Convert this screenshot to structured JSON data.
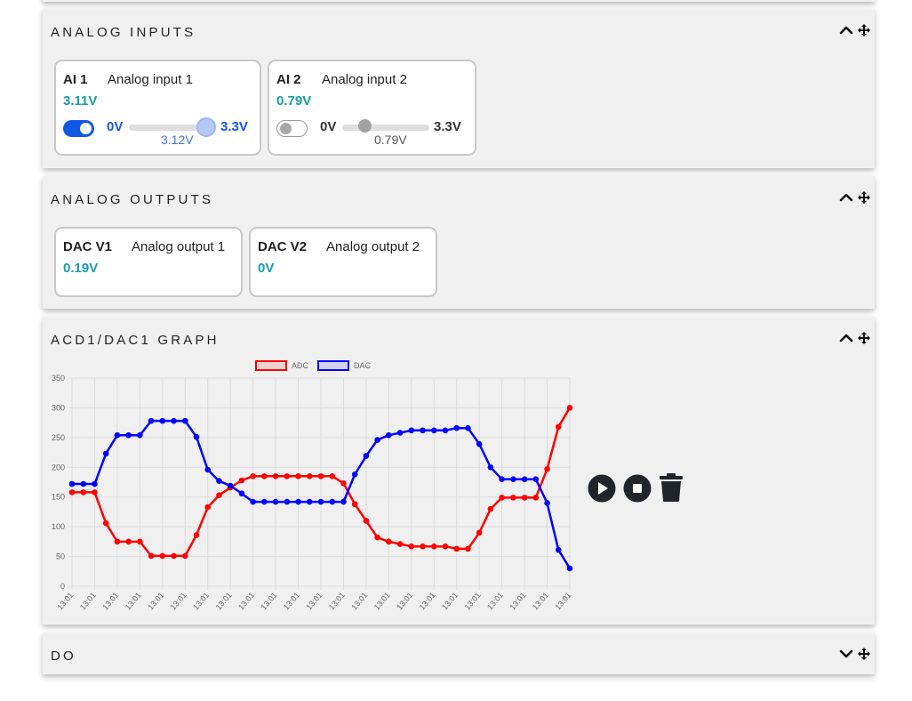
{
  "panels": {
    "analog_inputs": {
      "title": "ANALOG INPUTS"
    },
    "analog_outputs": {
      "title": "ANALOG OUTPUTS"
    },
    "graph": {
      "title": "ACD1/DAC1 GRAPH"
    },
    "do": {
      "title": "DO"
    }
  },
  "analog_inputs": [
    {
      "name": "AI 1",
      "description": "Analog input 1",
      "value": "3.11V",
      "toggle_on": true,
      "range_min": "0V",
      "range_max": "3.3V",
      "slider_value": "3.12V",
      "slider_fraction": 0.945
    },
    {
      "name": "AI 2",
      "description": "Analog input 2",
      "value": "0.79V",
      "toggle_on": false,
      "range_min": "0V",
      "range_max": "3.3V",
      "slider_value": "0.79V",
      "slider_fraction": 0.24
    }
  ],
  "analog_outputs": [
    {
      "name": "DAC V1",
      "description": "Analog output 1",
      "value": "0.19V"
    },
    {
      "name": "DAC V2",
      "description": "Analog output 2",
      "value": "0V"
    }
  ],
  "colors": {
    "accent": "#1357e6",
    "value_teal": "#1a9ca8",
    "adc": "#ff0000",
    "dac": "#0000ff",
    "panel_bg": "#f0f0f0"
  },
  "icons": [
    "chevron-up-icon",
    "move-arrows-icon",
    "chevron-down-icon",
    "play-icon",
    "stop-icon",
    "trash-icon"
  ],
  "chart_data": {
    "type": "line",
    "title": "",
    "xlabel": "",
    "ylabel": "",
    "ylim": [
      0,
      350
    ],
    "yticks": [
      0,
      50,
      100,
      150,
      200,
      250,
      300,
      350
    ],
    "grid": true,
    "legend_position": "top-center",
    "categories": [
      "13:01",
      "13:01",
      "13:01",
      "13:01",
      "13:01",
      "13:01",
      "13:01",
      "13:01",
      "13:01",
      "13:01",
      "13:01",
      "13:01",
      "13:01",
      "13:01",
      "13:01",
      "13:01",
      "13:01",
      "13:01",
      "13:01",
      "13:01",
      "13:01",
      "13:01",
      "13:01",
      "13:01",
      "13:01",
      "13:01",
      "13:01",
      "13:01",
      "13:01",
      "13:01",
      "13:01",
      "13:01",
      "13:01",
      "13:01",
      "13:01",
      "13:01",
      "13:01",
      "13:01",
      "13:01",
      "13:01",
      "13:01",
      "13:01",
      "13:01",
      "13:01",
      "13:01"
    ],
    "series": [
      {
        "name": "ADC",
        "color": "#ff0000",
        "values": [
          158,
          158,
          158,
          106,
          75,
          75,
          75,
          51,
          51,
          51,
          51,
          86,
          133,
          153,
          166,
          178,
          185,
          185,
          185,
          185,
          185,
          185,
          185,
          185,
          173,
          138,
          110,
          82,
          75,
          71,
          67,
          67,
          67,
          67,
          63,
          63,
          90,
          130,
          149,
          149,
          149,
          149,
          197,
          268,
          300
        ]
      },
      {
        "name": "DAC",
        "color": "#0000ff",
        "values": [
          172,
          172,
          172,
          223,
          254,
          254,
          254,
          278,
          278,
          278,
          278,
          251,
          196,
          177,
          169,
          156,
          142,
          142,
          142,
          142,
          142,
          142,
          142,
          142,
          142,
          188,
          219,
          246,
          254,
          258,
          262,
          262,
          262,
          262,
          266,
          266,
          239,
          200,
          180,
          180,
          180,
          180,
          140,
          61,
          30
        ]
      }
    ]
  }
}
